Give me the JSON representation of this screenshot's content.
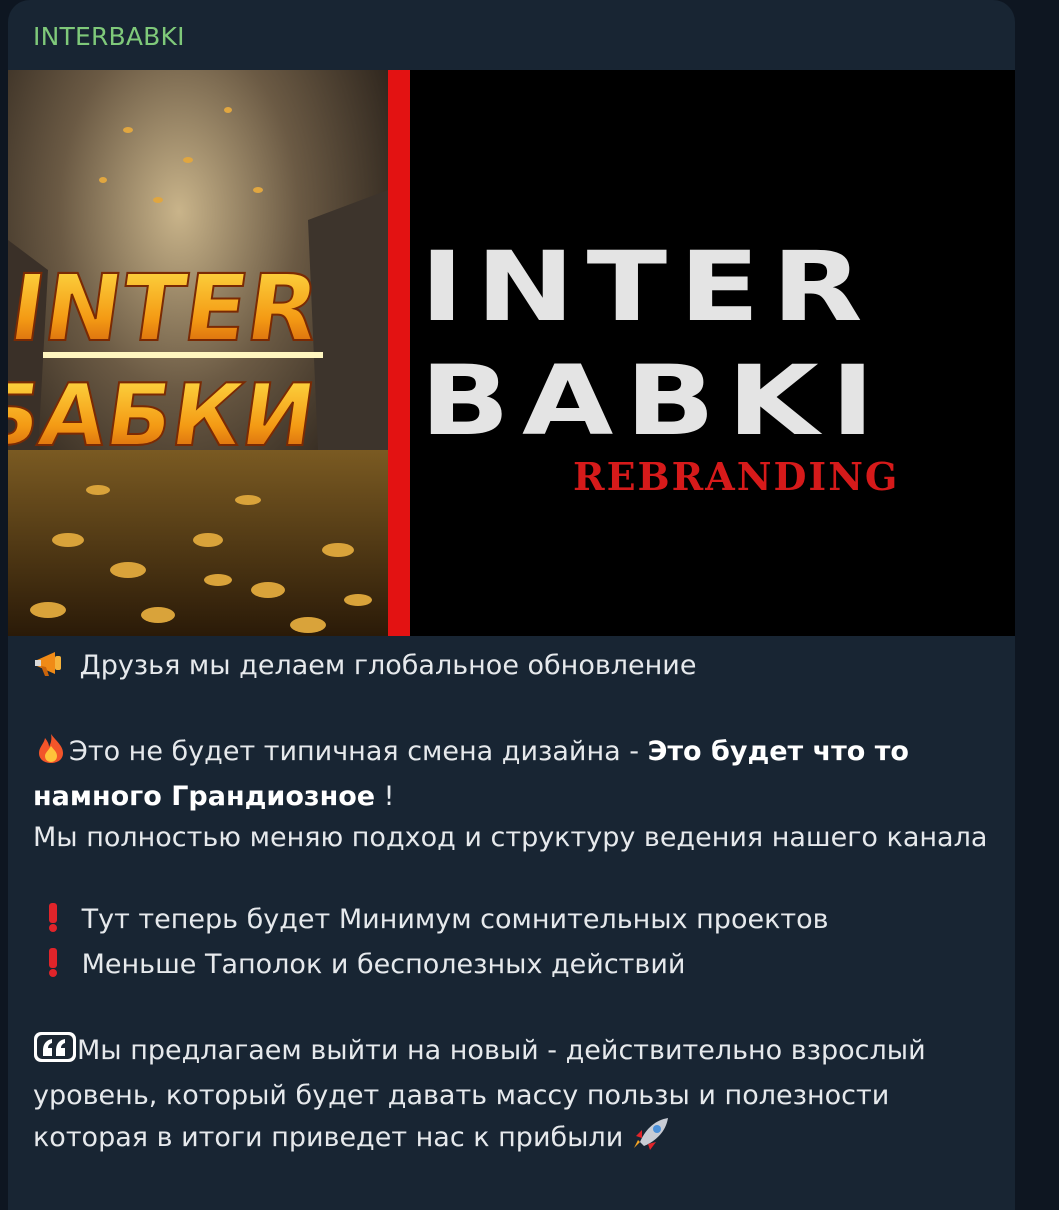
{
  "message": {
    "channel_name": "INTERBABKI",
    "banner": {
      "poster_line1": "INTER",
      "poster_line2": "БАБКИ",
      "title_line1": "INTER",
      "title_line2": "BABKI",
      "subtitle": "REBRANDING",
      "colors": {
        "accent_red": "#e31212",
        "title_gray": "#e4e4e4",
        "poster_gold": "#f2a316"
      }
    },
    "text": {
      "line1": "Друзья мы делаем глобальное обновление",
      "line2_plain": "Это не будет типичная смена дизайна  - ",
      "line2_bold": "Это будет что то намного Грандиозное",
      "line2_end": " !",
      "line3": "Мы полностью меняю подход и структуру ведения нашего канала",
      "bullet1": "Тут теперь будет Минимум сомнительных проектов",
      "bullet2": "Меньше Таполок и бесполезных действий",
      "line4": "Мы предлагаем выйти на новый - действительно взрослый уровень, который будет давать массу пользы и полезности которая в итоги приведет нас к прибыли"
    },
    "icons": [
      "megaphone-icon",
      "fire-icon",
      "exclamation-icon",
      "quote-icon",
      "rocket-icon"
    ]
  }
}
